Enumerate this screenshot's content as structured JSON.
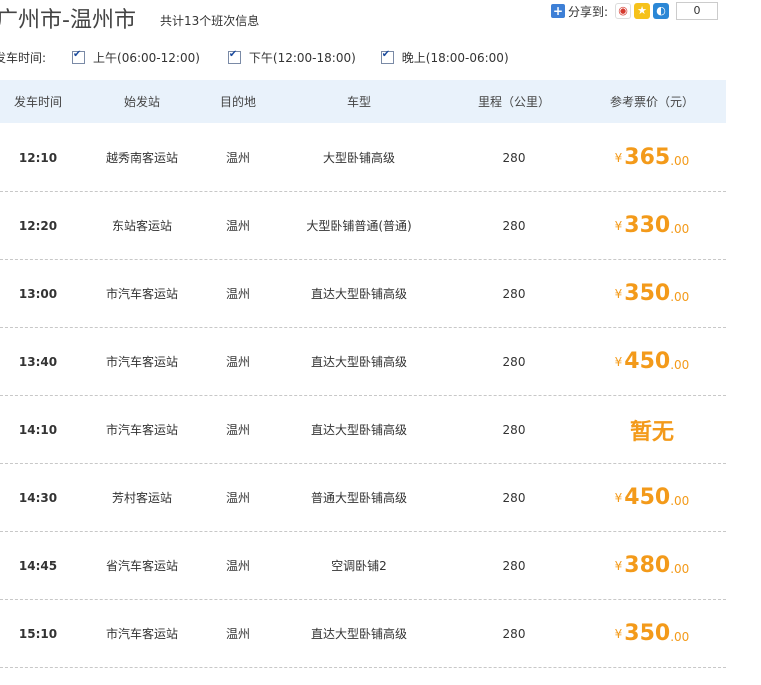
{
  "header": {
    "route_title": "广州市-温州市",
    "count_text": "共计13个班次信息",
    "share_label": "分享到:",
    "share_count": "0",
    "share_icons": [
      "weibo-icon",
      "qzone-icon",
      "tencent-weibo-icon"
    ]
  },
  "filters": {
    "label": "发车时间:",
    "options": [
      {
        "label": "上午(06:00-12:00)",
        "checked": true
      },
      {
        "label": "下午(12:00-18:00)",
        "checked": true
      },
      {
        "label": "晚上(18:00-06:00)",
        "checked": true
      }
    ]
  },
  "table": {
    "columns": [
      "发车时间",
      "始发站",
      "目的地",
      "车型",
      "里程（公里）",
      "参考票价（元）"
    ],
    "rows": [
      {
        "time": "12:10",
        "from": "越秀南客运站",
        "to": "温州",
        "type": "大型卧铺高级",
        "km": "280",
        "currency": "¥",
        "price_int": "365",
        "price_dec": ".00"
      },
      {
        "time": "12:20",
        "from": "东站客运站",
        "to": "温州",
        "type": "大型卧铺普通(普通)",
        "km": "280",
        "currency": "¥",
        "price_int": "330",
        "price_dec": ".00"
      },
      {
        "time": "13:00",
        "from": "市汽车客运站",
        "to": "温州",
        "type": "直达大型卧铺高级",
        "km": "280",
        "currency": "¥",
        "price_int": "350",
        "price_dec": ".00"
      },
      {
        "time": "13:40",
        "from": "市汽车客运站",
        "to": "温州",
        "type": "直达大型卧铺高级",
        "km": "280",
        "currency": "¥",
        "price_int": "450",
        "price_dec": ".00"
      },
      {
        "time": "14:10",
        "from": "市汽车客运站",
        "to": "温州",
        "type": "直达大型卧铺高级",
        "km": "280",
        "price_text": "暂无"
      },
      {
        "time": "14:30",
        "from": "芳村客运站",
        "to": "温州",
        "type": "普通大型卧铺高级",
        "km": "280",
        "currency": "¥",
        "price_int": "450",
        "price_dec": ".00"
      },
      {
        "time": "14:45",
        "from": "省汽车客运站",
        "to": "温州",
        "type": "空调卧铺2",
        "km": "280",
        "currency": "¥",
        "price_int": "380",
        "price_dec": ".00"
      },
      {
        "time": "15:10",
        "from": "市汽车客运站",
        "to": "温州",
        "type": "直达大型卧铺高级",
        "km": "280",
        "currency": "¥",
        "price_int": "350",
        "price_dec": ".00"
      }
    ]
  },
  "colors": {
    "price": "#f39a1a",
    "header_bg": "#e9f2fb",
    "share_blue": "#3d7fd6"
  }
}
